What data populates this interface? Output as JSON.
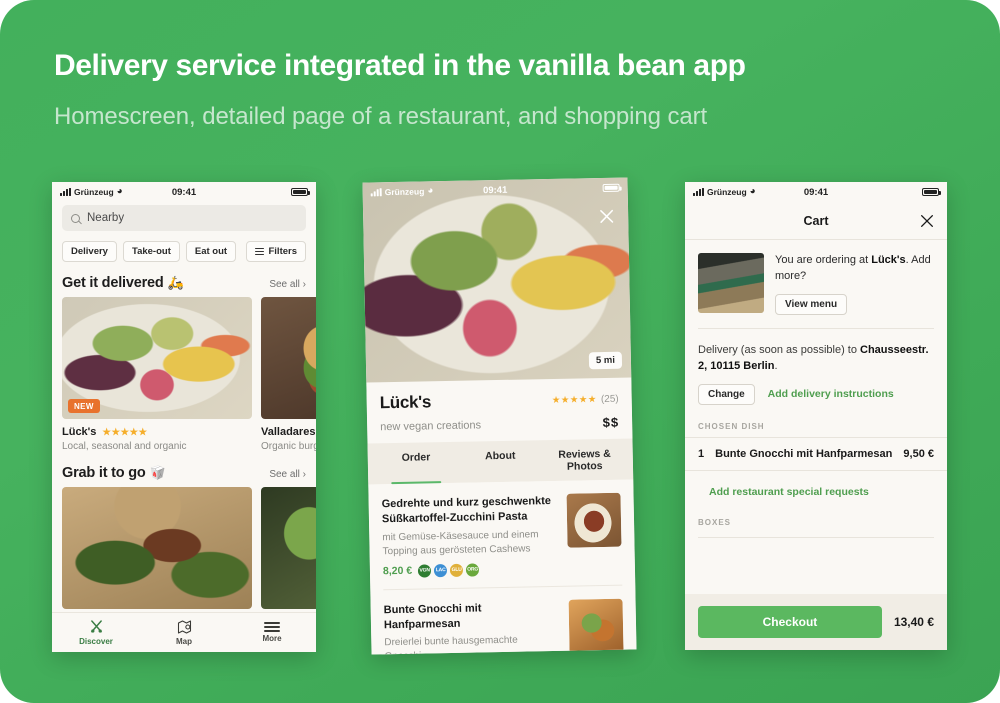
{
  "slide": {
    "headline": "Delivery service integrated in the vanilla bean app",
    "subhead": "Homescreen, detailed page of a restaurant, and shopping cart",
    "bg_color": "#43b05c",
    "accent_green": "#5bb860"
  },
  "status_bar": {
    "carrier": "Grünzeug",
    "time": "09:41"
  },
  "phone1": {
    "search": {
      "placeholder": "Nearby"
    },
    "chips": [
      {
        "label": "Delivery"
      },
      {
        "label": "Take-out"
      },
      {
        "label": "Eat out"
      },
      {
        "label": "Filters"
      }
    ],
    "sections": [
      {
        "title": "Get it delivered",
        "emoji": "🛵",
        "see_all": "See all ›",
        "cards": [
          {
            "name": "Lück's",
            "stars": "★★★★★",
            "desc": "Local, seasonal and organic",
            "badge": "NEW"
          },
          {
            "name": "Valladares",
            "stars": "",
            "desc": "Organic burgers",
            "badge": ""
          }
        ]
      },
      {
        "title": "Grab it to go",
        "emoji": "🥡",
        "see_all": "See all ›",
        "cards": [
          {
            "name": "",
            "stars": "",
            "desc": "",
            "badge": ""
          },
          {
            "name": "",
            "stars": "",
            "desc": "",
            "badge": ""
          }
        ]
      }
    ],
    "tabbar": [
      {
        "label": "Discover",
        "active": true
      },
      {
        "label": "Map",
        "active": false
      },
      {
        "label": "More",
        "active": false
      }
    ]
  },
  "phone2": {
    "distance_badge": "5 mi",
    "restaurant": {
      "name": "Lück's",
      "stars": "★★★★★",
      "review_count": "(25)",
      "subtitle": "new vegan creations",
      "price_level": "$$"
    },
    "tabs": [
      {
        "label": "Order",
        "active": true
      },
      {
        "label": "About",
        "active": false
      },
      {
        "label": "Reviews & Photos",
        "active": false
      }
    ],
    "menu": [
      {
        "title": "Gedrehte und kurz geschwenkte Süßkartoffel-Zucchini Pasta",
        "desc": "mit Gemüse-Käsesauce und einem Topping aus gerösteten Cashews",
        "price": "8,20 €",
        "tags": [
          {
            "label": "VGN",
            "color": "#2f7d32"
          },
          {
            "label": "LAC",
            "color": "#3d8fd4"
          },
          {
            "label": "GLU",
            "color": "#e0b03a"
          },
          {
            "label": "ORG",
            "color": "#6aa83c"
          }
        ]
      },
      {
        "title": "Bunte Gnocchi mit Hanfparmesan",
        "desc": "Dreierlei bunte hausgemachte Gnocchi,",
        "price": "",
        "tags": []
      }
    ]
  },
  "phone3": {
    "header": {
      "title": "Cart"
    },
    "ordering": {
      "text_prefix": "You are ordering at ",
      "restaurant": "Lück's",
      "text_suffix": ". Add more?",
      "view_menu": "View menu"
    },
    "delivery": {
      "text_prefix": "Delivery (as soon as possible) to ",
      "address": "Chausseestr. 2, 10115 Berlin",
      "text_suffix": ".",
      "change_label": "Change",
      "instructions_label": "Add delivery instructions"
    },
    "chosen_dish_label": "CHOSEN DISH",
    "dish": {
      "qty": "1",
      "name": "Bunte Gnocchi mit Hanfparmesan",
      "price": "9,50 €"
    },
    "special_requests_label": "Add restaurant special requests",
    "boxes_label": "BOXES",
    "checkout": {
      "label": "Checkout",
      "total": "13,40 €"
    }
  }
}
